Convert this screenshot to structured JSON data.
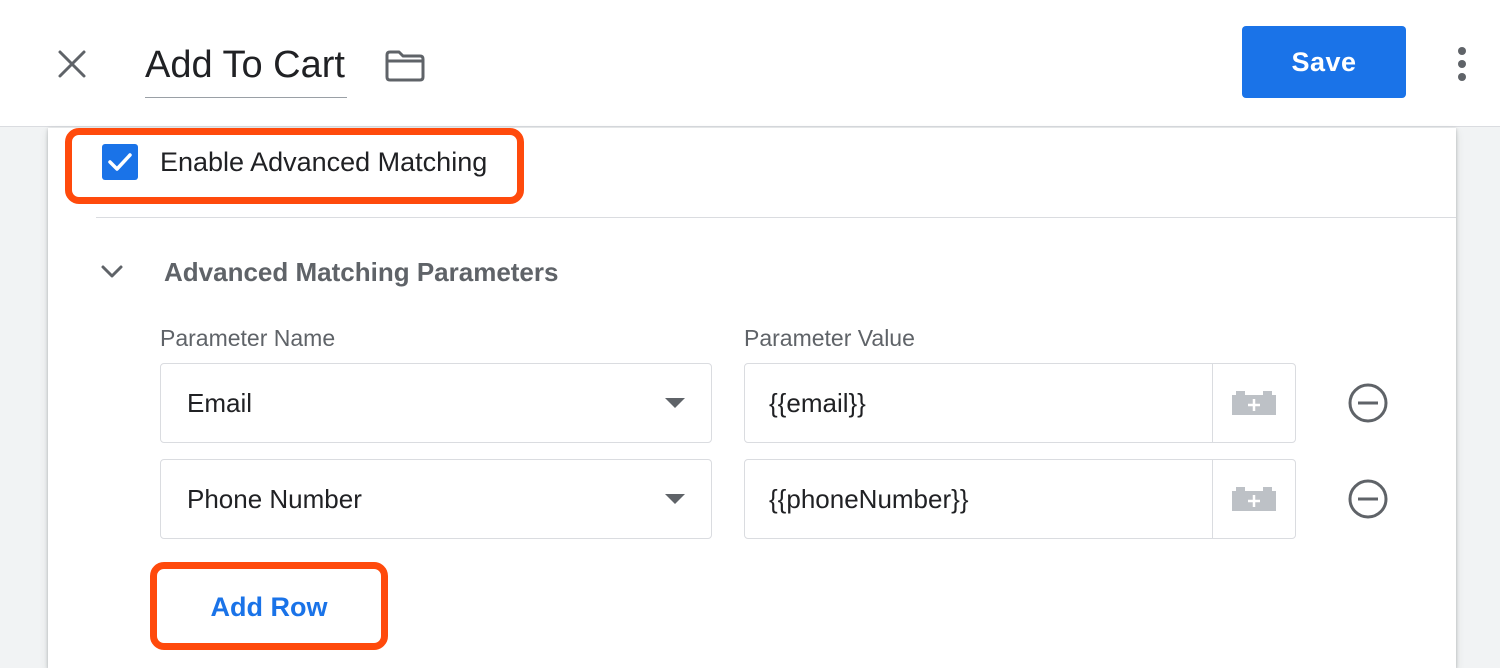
{
  "header": {
    "title": "Add To Cart",
    "save_label": "Save"
  },
  "advanced_matching": {
    "checkbox_label": "Enable Advanced Matching",
    "checked": true,
    "section_title": "Advanced Matching Parameters",
    "columns": {
      "name": "Parameter Name",
      "value": "Parameter Value"
    },
    "rows": [
      {
        "name": "Email",
        "value": "{{email}}"
      },
      {
        "name": "Phone Number",
        "value": "{{phoneNumber}}"
      }
    ],
    "add_row_label": "Add Row"
  },
  "icons": {
    "close": "close-icon",
    "folder": "folder-icon",
    "more": "more-vert-icon",
    "check": "check-icon",
    "chevron": "chevron-down-icon",
    "variable": "variable-icon",
    "remove": "remove-circle-icon"
  },
  "colors": {
    "accent": "#1a73e8",
    "highlight": "#ff4a0c",
    "muted_text": "#5f6368",
    "border": "#dadce0"
  }
}
